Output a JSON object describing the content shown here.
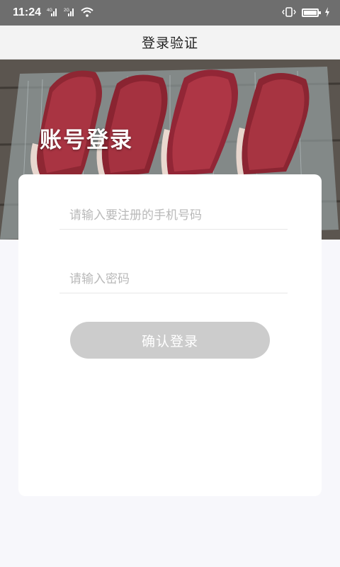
{
  "status_bar": {
    "time": "11:24",
    "network_labels": [
      "4G",
      "2G"
    ],
    "icons": [
      "signal-icon",
      "signal-icon",
      "wifi-icon",
      "vibrate-icon",
      "battery-icon",
      "charging-icon"
    ]
  },
  "nav": {
    "title": "登录验证"
  },
  "banner": {
    "title": "账号登录",
    "image": "raw-steaks-on-tray"
  },
  "form": {
    "phone_placeholder": "请输入要注册的手机号码",
    "phone_value": "",
    "password_placeholder": "请输入密码",
    "password_value": "",
    "submit_label": "确认登录"
  },
  "colors": {
    "status_bar": "#6e6e6e",
    "nav_bg": "#f3f3f3",
    "page_bg": "#f7f7fb",
    "button_disabled": "#cccccc"
  }
}
